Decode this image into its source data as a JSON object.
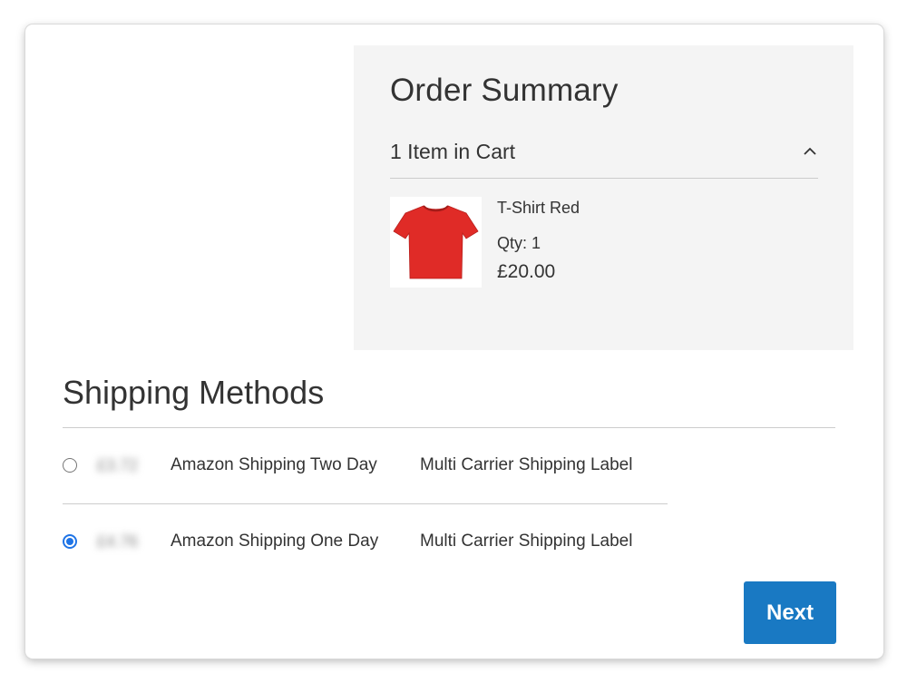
{
  "order_summary": {
    "title": "Order Summary",
    "cart_count_label": "1 Item in Cart",
    "toggle_icon": "chevron-up-icon",
    "item": {
      "name": "T-Shirt Red",
      "qty_label": "Qty: 1",
      "price": "£20.00",
      "image_icon": "red-tshirt-image"
    }
  },
  "shipping": {
    "title": "Shipping Methods",
    "methods": [
      {
        "price": "£3.72",
        "method": "Amazon Shipping Two Day",
        "carrier": "Multi Carrier Shipping Label",
        "selected": false
      },
      {
        "price": "£4.76",
        "method": "Amazon Shipping One Day",
        "carrier": "Multi Carrier Shipping Label",
        "selected": true
      }
    ]
  },
  "next_label": "Next",
  "colors": {
    "accent": "#1979c3",
    "radio_selected": "#1f74e6",
    "summary_bg": "#f4f4f4",
    "product": "#e02b27"
  }
}
